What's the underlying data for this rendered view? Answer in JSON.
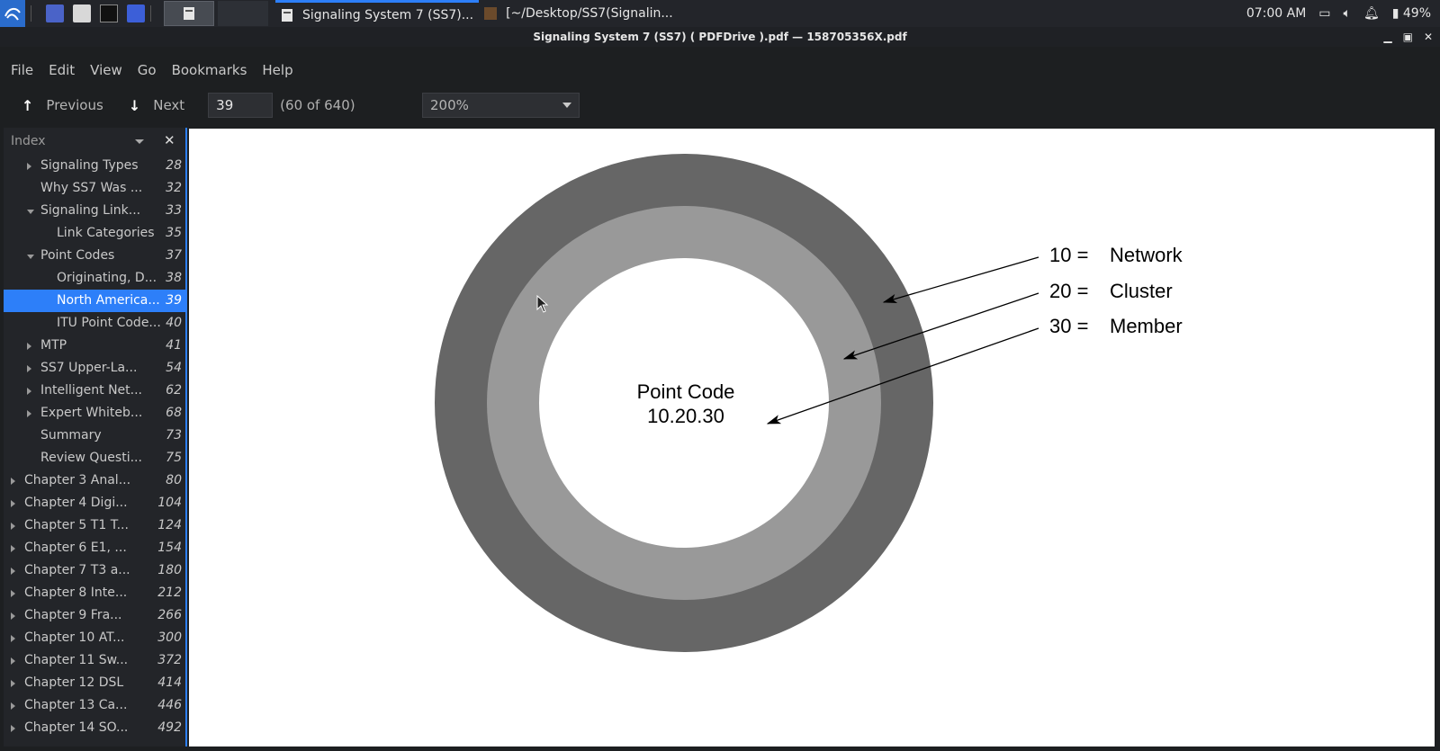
{
  "taskbar": {
    "tasks": [
      {
        "label": "Signaling System 7 (SS7)...",
        "active": true
      },
      {
        "label": "[~/Desktop/SS7(Signalin...",
        "active": false
      }
    ],
    "clock": "07:00 AM",
    "battery": "49%"
  },
  "window": {
    "title": "Signaling System 7 (SS7) ( PDFDrive ).pdf — 158705356X.pdf"
  },
  "menu": [
    "File",
    "Edit",
    "View",
    "Go",
    "Bookmarks",
    "Help"
  ],
  "toolbar": {
    "previous_label": "Previous",
    "next_label": "Next",
    "page_value": "39",
    "page_info": "(60 of 640)",
    "zoom_value": "200%"
  },
  "sidebar": {
    "title": "Index",
    "items": [
      {
        "label": "Signaling Types",
        "page": "28",
        "level": 1,
        "expander": "right"
      },
      {
        "label": "Why SS7 Was ...",
        "page": "32",
        "level": 1,
        "expander": "none"
      },
      {
        "label": "Signaling Link...",
        "page": "33",
        "level": 1,
        "expander": "down"
      },
      {
        "label": "Link Categories",
        "page": "35",
        "level": 2,
        "expander": "none"
      },
      {
        "label": "Point Codes",
        "page": "37",
        "level": 1,
        "expander": "down"
      },
      {
        "label": "Originating, D...",
        "page": "38",
        "level": 2,
        "expander": "none"
      },
      {
        "label": "North America...",
        "page": "39",
        "level": 2,
        "expander": "none",
        "selected": true
      },
      {
        "label": "ITU Point Code...",
        "page": "40",
        "level": 2,
        "expander": "none"
      },
      {
        "label": "MTP",
        "page": "41",
        "level": 1,
        "expander": "right"
      },
      {
        "label": "SS7 Upper-La...",
        "page": "54",
        "level": 1,
        "expander": "right"
      },
      {
        "label": "Intelligent Net...",
        "page": "62",
        "level": 1,
        "expander": "right"
      },
      {
        "label": "Expert Whiteb...",
        "page": "68",
        "level": 1,
        "expander": "right"
      },
      {
        "label": "Summary",
        "page": "73",
        "level": 1,
        "expander": "none"
      },
      {
        "label": "Review Questi...",
        "page": "75",
        "level": 1,
        "expander": "none"
      },
      {
        "label": "Chapter 3 Anal...",
        "page": "80",
        "level": 0,
        "expander": "right"
      },
      {
        "label": "Chapter 4 Digi...",
        "page": "104",
        "level": 0,
        "expander": "right"
      },
      {
        "label": "Chapter 5 T1 T...",
        "page": "124",
        "level": 0,
        "expander": "right"
      },
      {
        "label": "Chapter 6 E1, ...",
        "page": "154",
        "level": 0,
        "expander": "right"
      },
      {
        "label": "Chapter 7 T3 a...",
        "page": "180",
        "level": 0,
        "expander": "right"
      },
      {
        "label": "Chapter 8 Inte...",
        "page": "212",
        "level": 0,
        "expander": "right"
      },
      {
        "label": "Chapter 9 Fra...",
        "page": "266",
        "level": 0,
        "expander": "right"
      },
      {
        "label": "Chapter 10 AT...",
        "page": "300",
        "level": 0,
        "expander": "right"
      },
      {
        "label": "Chapter 11 Sw...",
        "page": "372",
        "level": 0,
        "expander": "right"
      },
      {
        "label": "Chapter 12 DSL",
        "page": "414",
        "level": 0,
        "expander": "right"
      },
      {
        "label": "Chapter 13 Ca...",
        "page": "446",
        "level": 0,
        "expander": "right"
      },
      {
        "label": "Chapter 14 SO...",
        "page": "492",
        "level": 0,
        "expander": "right"
      }
    ]
  },
  "figure": {
    "center_line1": "Point Code",
    "center_line2": "10.20.30",
    "labels": [
      {
        "num": "10 =",
        "name": "Network"
      },
      {
        "num": "20 =",
        "name": "Cluster"
      },
      {
        "num": "30 =",
        "name": "Member"
      }
    ],
    "colors": {
      "outer": "#666666",
      "middle": "#999999",
      "inner": "#ffffff"
    }
  },
  "colors": {
    "accent": "#2d7ff9",
    "background": "#1d1f21"
  }
}
